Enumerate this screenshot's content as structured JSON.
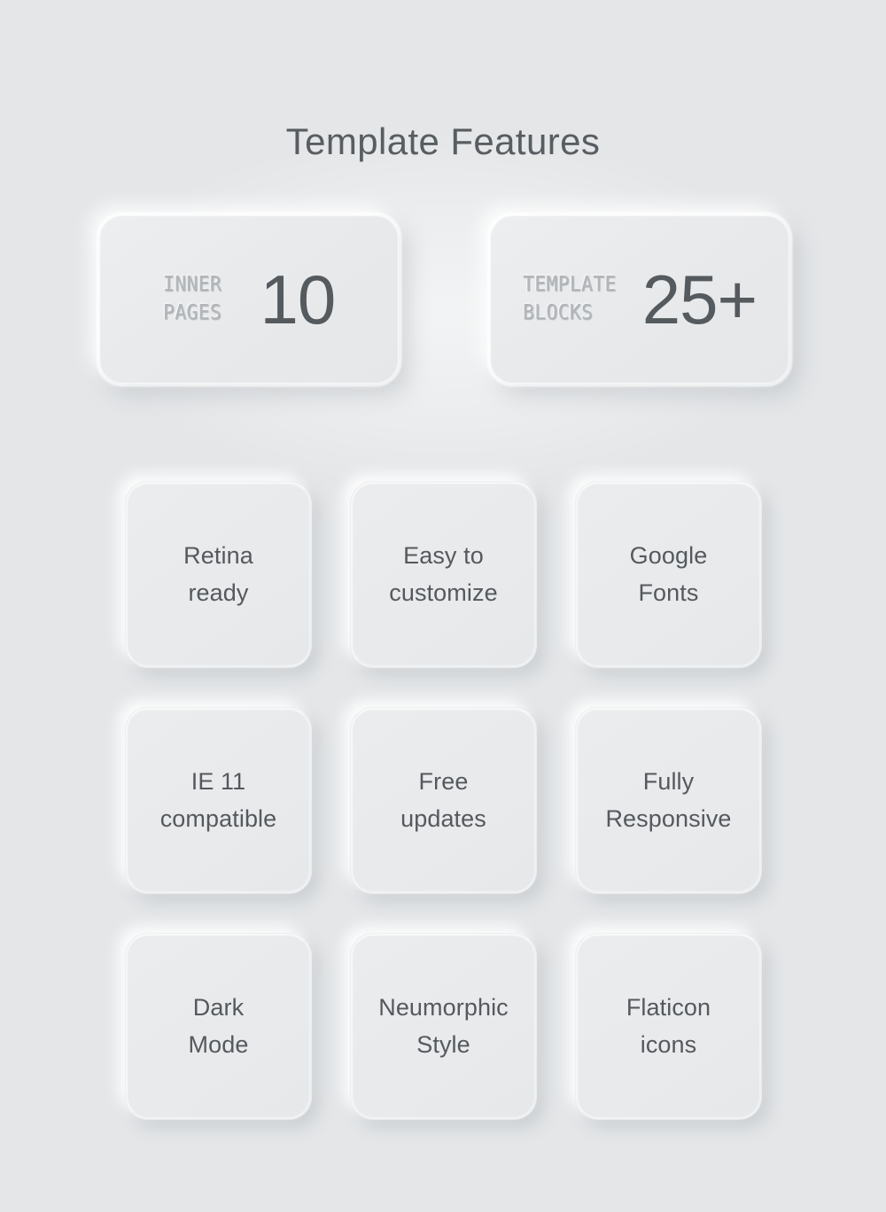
{
  "page": {
    "background_color": "#e4e6e8",
    "title": "Template Features"
  },
  "stats": [
    {
      "label": "INNER\nPAGES",
      "value": "10",
      "label_color": "#b3b7ba",
      "value_color": "#555a5e"
    },
    {
      "label": "TEMPLATE\nBLOCKS",
      "value": "25+",
      "label_color": "#b3b7ba",
      "value_color": "#555a5e"
    }
  ],
  "features": [
    {
      "label": "Retina\nready"
    },
    {
      "label": "Easy to\ncustomize"
    },
    {
      "label": "Google\nFonts"
    },
    {
      "label": "IE 11\ncompatible"
    },
    {
      "label": "Free\nupdates"
    },
    {
      "label": "Fully\nResponsive"
    },
    {
      "label": "Dark\nMode"
    },
    {
      "label": "Neumorphic\nStyle"
    },
    {
      "label": "Flaticon\nicons"
    }
  ]
}
